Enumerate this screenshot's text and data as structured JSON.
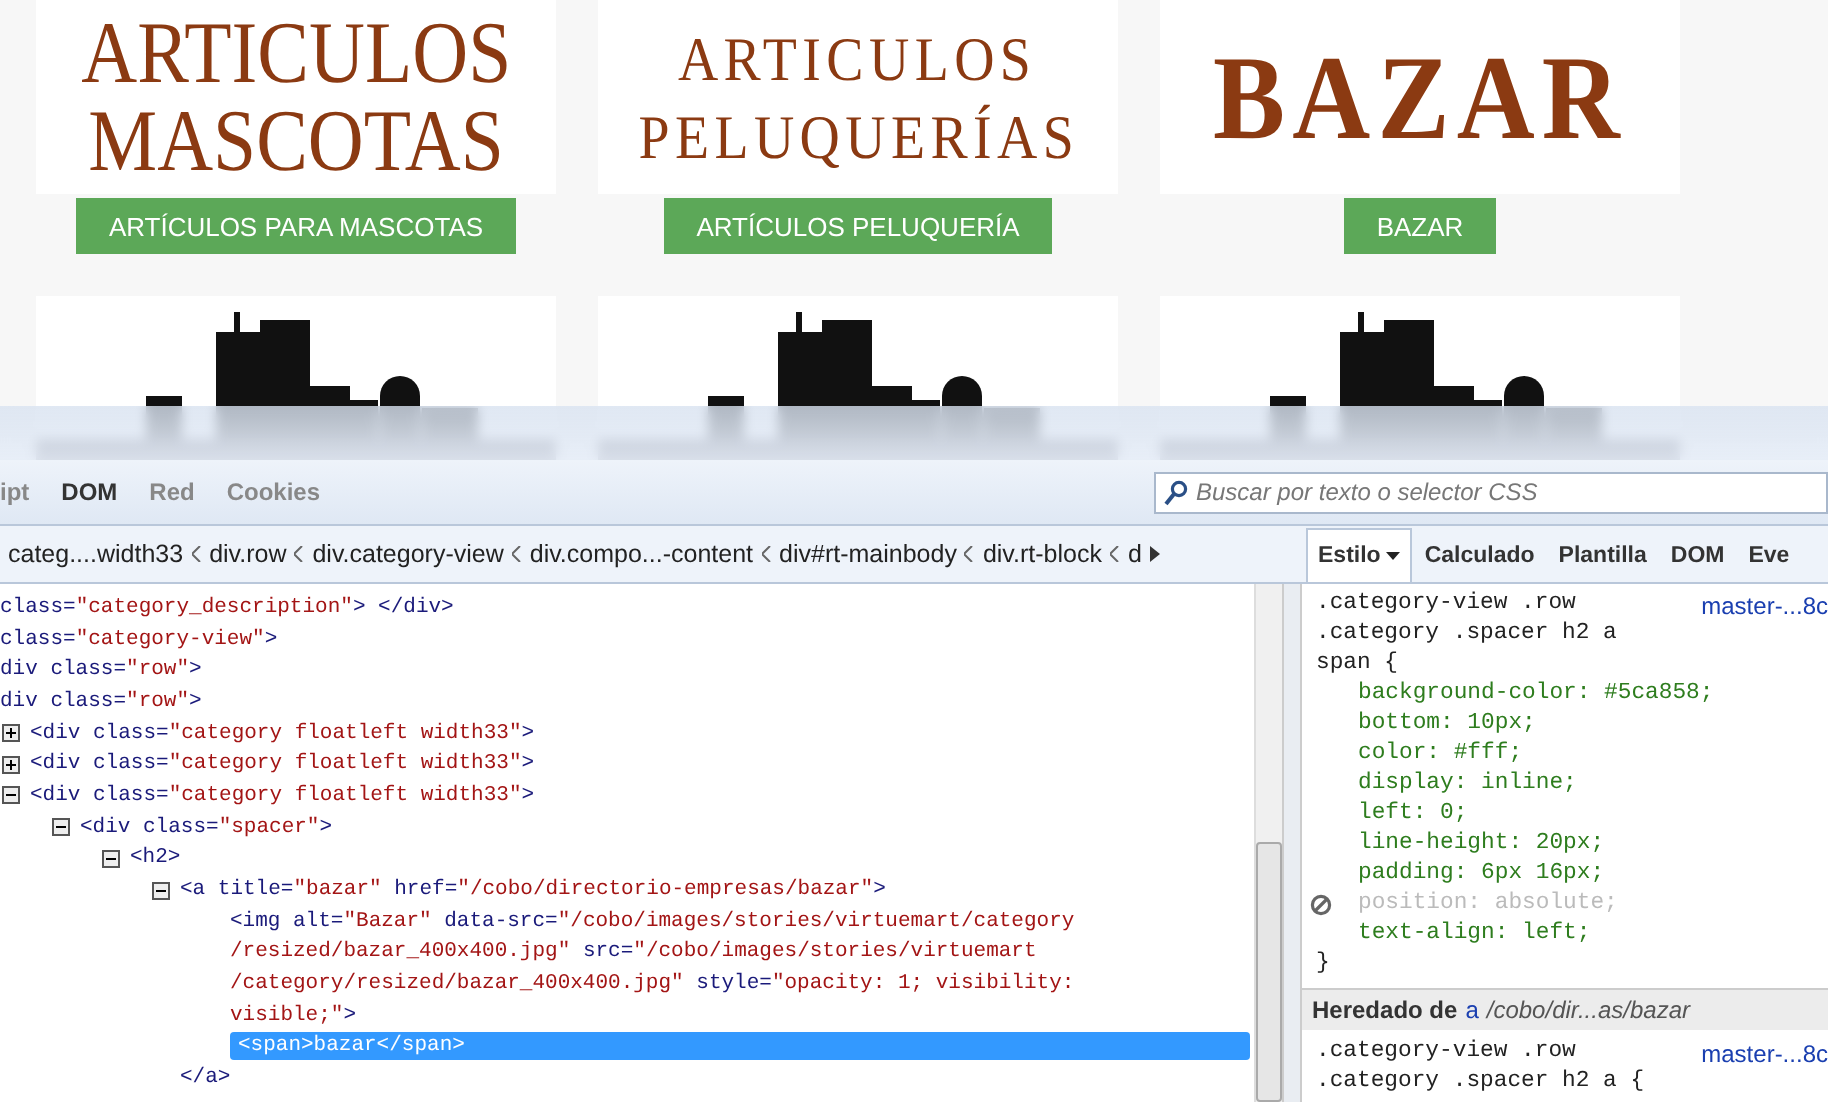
{
  "categories": [
    {
      "logo": {
        "kind": "large",
        "lines": [
          "ARTICULOS",
          "MASCOTAS"
        ]
      },
      "button": "ARTÍCULOS PARA MASCOTAS"
    },
    {
      "logo": {
        "kind": "small",
        "lines": [
          "ARTICULOS",
          "PELUQUERÍAS"
        ]
      },
      "button": "ARTÍCULOS PELUQUERÍA"
    },
    {
      "logo": {
        "kind": "bold",
        "lines": [
          "BAZAR"
        ]
      },
      "button": "BAZAR"
    }
  ],
  "devtools": {
    "tabs": [
      {
        "label": "ipt",
        "selected": false
      },
      {
        "label": "DOM",
        "selected": true
      },
      {
        "label": "Red",
        "selected": false
      },
      {
        "label": "Cookies",
        "selected": false
      }
    ],
    "search": {
      "placeholder": "Buscar por texto o selector CSS"
    },
    "breadcrumbs": [
      "categ....width33",
      "div.row",
      "div.category-view",
      "div.compo...-content",
      "div#rt-mainbody",
      "div.rt-block",
      "d"
    ],
    "side_tabs": [
      {
        "label": "Estilo",
        "selected": true,
        "menu": true
      },
      {
        "label": "Calculado",
        "selected": false,
        "menu": false
      },
      {
        "label": "Plantilla",
        "selected": false,
        "menu": false
      },
      {
        "label": "DOM",
        "selected": false,
        "menu": false
      },
      {
        "label": "Eve",
        "selected": false,
        "menu": false
      }
    ],
    "tree": [
      {
        "text": "class=\"category_description\">  </div>"
      },
      {
        "text": "class=\"category-view\">"
      },
      {
        "text": "div class=\"row\">"
      },
      {
        "text": "div class=\"row\">",
        "children": [
          {
            "text": "<div class=\"category floatleft width33\">",
            "expanded": false
          },
          {
            "text": "<div class=\"category floatleft width33\">",
            "expanded": false
          },
          {
            "text": "<div class=\"category floatleft width33\">",
            "expanded": true,
            "children": [
              {
                "text": "<div class=\"spacer\">",
                "expanded": true,
                "children": [
                  {
                    "text": "<h2>",
                    "expanded": true,
                    "children": [
                      {
                        "text": "<a title=\"bazar\" href=\"/cobo/directorio-empresas/bazar\">",
                        "expanded": true,
                        "children": [
                          {
                            "lines": [
                              "<img alt=\"Bazar\" data-src=\"/cobo/images/stories/virtuemart/category",
                              "/resized/bazar_400x400.jpg\" src=\"/cobo/images/stories/virtuemart",
                              "/category/resized/bazar_400x400.jpg\" style=\"opacity: 1; visibility:",
                              "visible;\">"
                            ]
                          },
                          {
                            "text": "<span>bazar</span>",
                            "selected": true
                          }
                        ]
                      },
                      {
                        "text": "</a>"
                      }
                    ]
                  }
                ]
              }
            ]
          }
        ]
      }
    ],
    "rules": [
      {
        "selector": [
          ".category-view .row",
          ".category .spacer h2 a",
          "span {"
        ],
        "source": "master-...8c",
        "properties": [
          {
            "text": "background-color: #5ca858;",
            "disabled": false
          },
          {
            "text": "bottom: 10px;",
            "disabled": false
          },
          {
            "text": "color: #fff;",
            "disabled": false
          },
          {
            "text": "display: inline;",
            "disabled": false
          },
          {
            "text": "left: 0;",
            "disabled": false
          },
          {
            "text": "line-height: 20px;",
            "disabled": false
          },
          {
            "text": "padding: 6px 16px;",
            "disabled": false
          },
          {
            "text": "position: absolute;",
            "disabled": true
          },
          {
            "text": "text-align: left;",
            "disabled": false
          }
        ],
        "close": "}"
      }
    ],
    "inherited": {
      "label": "Heredado de",
      "element": "a",
      "path": "/cobo/dir...as/bazar"
    },
    "inherited_rule": {
      "selector": [
        ".category-view .row",
        ".category .spacer h2 a {"
      ],
      "source": "master-...8c"
    }
  }
}
